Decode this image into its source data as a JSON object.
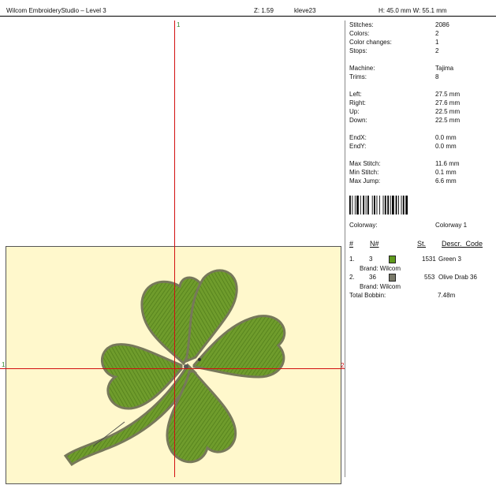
{
  "header": {
    "title": "Wilcom EmbroideryStudio – Level 3",
    "zoom": "Z: 1.59",
    "design": "kleve23",
    "size": "H: 45.0 mm  W: 55.1 mm"
  },
  "canvas": {
    "marker_top": "1",
    "marker_left": "1",
    "marker_right": "2",
    "hoop_color": "#fff8cc",
    "leaf_color": "#5f8f22",
    "outline_color": "#77785a"
  },
  "stats": [
    {
      "label": "Stitches:",
      "value": "2086"
    },
    {
      "label": "Colors:",
      "value": "2"
    },
    {
      "label": "Color changes:",
      "value": "1"
    },
    {
      "label": "Stops:",
      "value": "2"
    }
  ],
  "machine": [
    {
      "label": "Machine:",
      "value": "Tajima"
    },
    {
      "label": "Trims:",
      "value": "8"
    }
  ],
  "extents": [
    {
      "label": "Left:",
      "value": "27.5 mm"
    },
    {
      "label": "Right:",
      "value": "27.6 mm"
    },
    {
      "label": "Up:",
      "value": "22.5 mm"
    },
    {
      "label": "Down:",
      "value": "22.5 mm"
    }
  ],
  "ends": [
    {
      "label": "EndX:",
      "value": "0.0 mm"
    },
    {
      "label": "EndY:",
      "value": "0.0 mm"
    }
  ],
  "limits": [
    {
      "label": "Max Stitch:",
      "value": "11.6 mm"
    },
    {
      "label": "Min Stitch:",
      "value": "0.1 mm"
    },
    {
      "label": "Max Jump:",
      "value": "6.6 mm"
    }
  ],
  "colorway": {
    "label": "Colorway:",
    "value": "Colorway 1"
  },
  "table": {
    "headers": [
      "#",
      "N#",
      "St.",
      "Descr._Code"
    ],
    "rows": [
      {
        "num": "1.",
        "needle": "3",
        "swatch": "#5f9a1c",
        "stitches": "1531",
        "descr": "Green 3",
        "brand": "Brand: Wilcom"
      },
      {
        "num": "2.",
        "needle": "36",
        "swatch": "#7a7a6a",
        "stitches": "553",
        "descr": "Olive Drab 36",
        "brand": "Brand: Wilcom"
      }
    ]
  },
  "bobbin": {
    "label": "Total Bobbin:",
    "value": "7.48m"
  }
}
